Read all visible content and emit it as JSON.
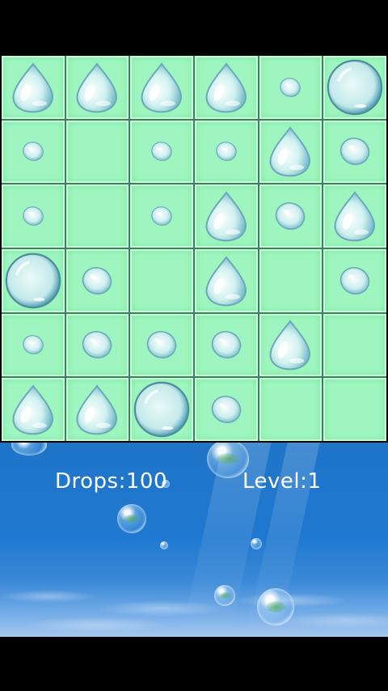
{
  "hud": {
    "drops_label": "Drops:100",
    "level_label": "Level:1"
  },
  "board": {
    "rows": [
      [
        "large-drop",
        "large-drop",
        "large-drop",
        "large-drop",
        "small-drop",
        "bubble"
      ],
      [
        "small-drop",
        "empty",
        "small-drop",
        "small-drop",
        "large-drop",
        "medium-drop"
      ],
      [
        "small-drop",
        "empty",
        "small-drop",
        "large-drop",
        "medium-drop",
        "large-drop"
      ],
      [
        "bubble",
        "medium-drop",
        "empty",
        "large-drop",
        "empty",
        "medium-drop"
      ],
      [
        "small-drop",
        "medium-drop",
        "medium-drop",
        "medium-drop",
        "large-drop",
        "empty"
      ],
      [
        "large-drop",
        "large-drop",
        "bubble",
        "medium-drop",
        "empty",
        "empty"
      ]
    ]
  },
  "colors": {
    "tile": "#9ff5bf",
    "sea": "#1f74c8",
    "text": "#ffffff"
  }
}
